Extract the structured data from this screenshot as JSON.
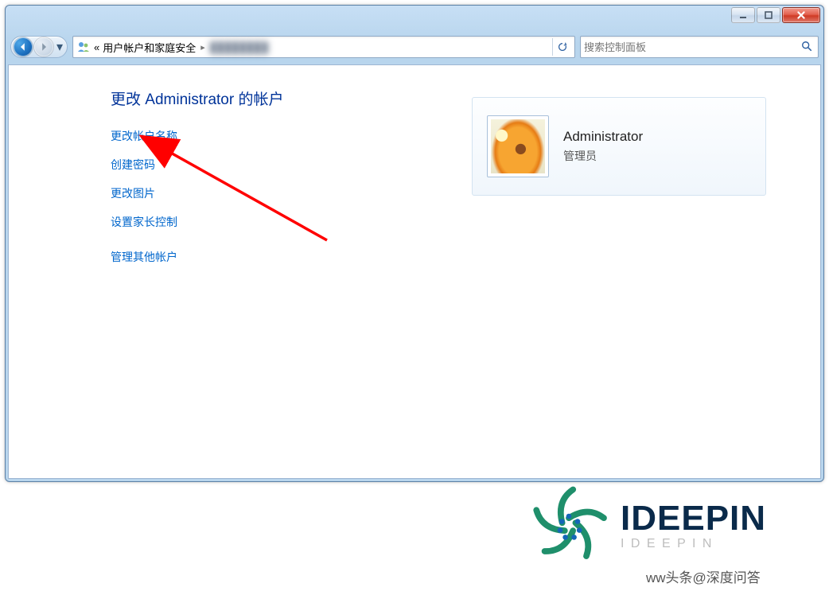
{
  "breadcrumb": {
    "sep1": "«",
    "segment": "用户帐户和家庭安全",
    "arrow": "▸"
  },
  "search": {
    "placeholder": "搜索控制面板"
  },
  "page_title": "更改 Administrator 的帐户",
  "links": {
    "change_name": "更改帐户名称",
    "create_password": "创建密码",
    "change_picture": "更改图片",
    "parental_controls": "设置家长控制",
    "manage_other": "管理其他帐户"
  },
  "account": {
    "name": "Administrator",
    "role": "管理员"
  },
  "brand": {
    "title": "IDEEPIN",
    "subtitle": "I D E E P I N"
  },
  "byline": "ww头条@深度问答"
}
